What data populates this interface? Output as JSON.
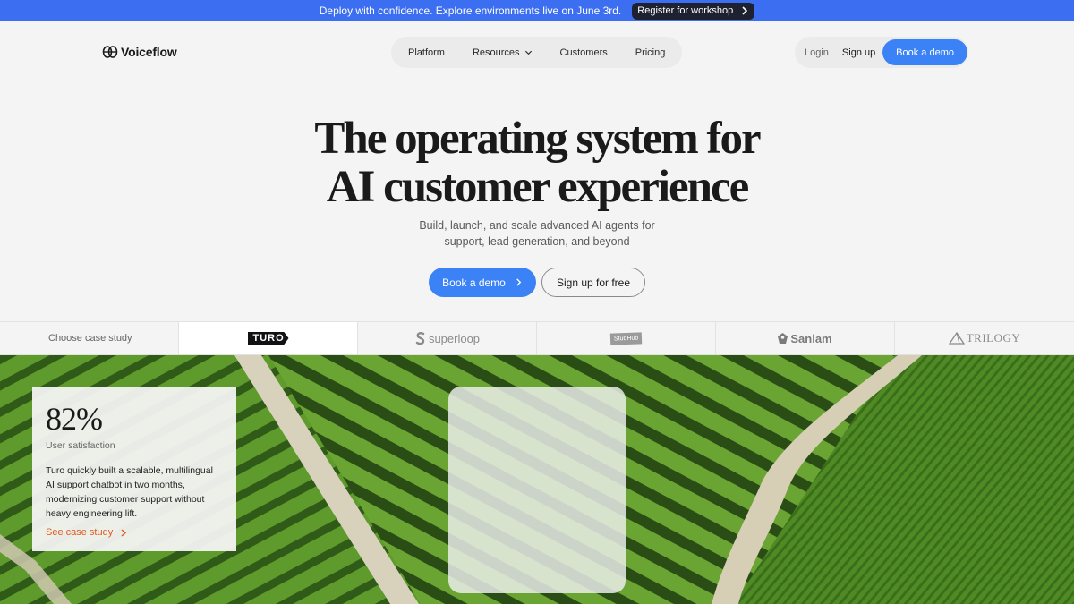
{
  "announcement": {
    "text": "Deploy with confidence. Explore environments live on June 3rd.",
    "button_label": "Register for workshop"
  },
  "nav": {
    "brand": "Voiceflow",
    "items": [
      {
        "label": "Platform"
      },
      {
        "label": "Resources",
        "has_dropdown": true
      },
      {
        "label": "Customers"
      },
      {
        "label": "Pricing"
      }
    ],
    "login": "Login",
    "signup": "Sign up",
    "book_demo": "Book a demo"
  },
  "hero": {
    "headline_line1": "The operating system for",
    "headline_line2": "AI customer experience",
    "sub_line1": "Build, launch, and scale advanced AI agents for",
    "sub_line2": "support, lead generation, and beyond",
    "cta_primary": "Book a demo",
    "cta_secondary": "Sign up for free"
  },
  "case_studies": {
    "prompt": "Choose case study",
    "logos": [
      {
        "name": "TURO",
        "active": true
      },
      {
        "name": "superloop"
      },
      {
        "name": "StubHub"
      },
      {
        "name": "Sanlam"
      },
      {
        "name": "TRILOGY"
      }
    ]
  },
  "stat_card": {
    "value": "82%",
    "label": "User satisfaction",
    "description": "Turo quickly built a scalable, multilingual AI support chatbot in two months, modernizing customer support without heavy engineering lift.",
    "link": "See case study"
  },
  "colors": {
    "announcement_bg": "#3b6ef0",
    "primary_blue": "#3b82f6",
    "link_orange": "#e0591e",
    "page_bg": "#f4f4f4"
  }
}
